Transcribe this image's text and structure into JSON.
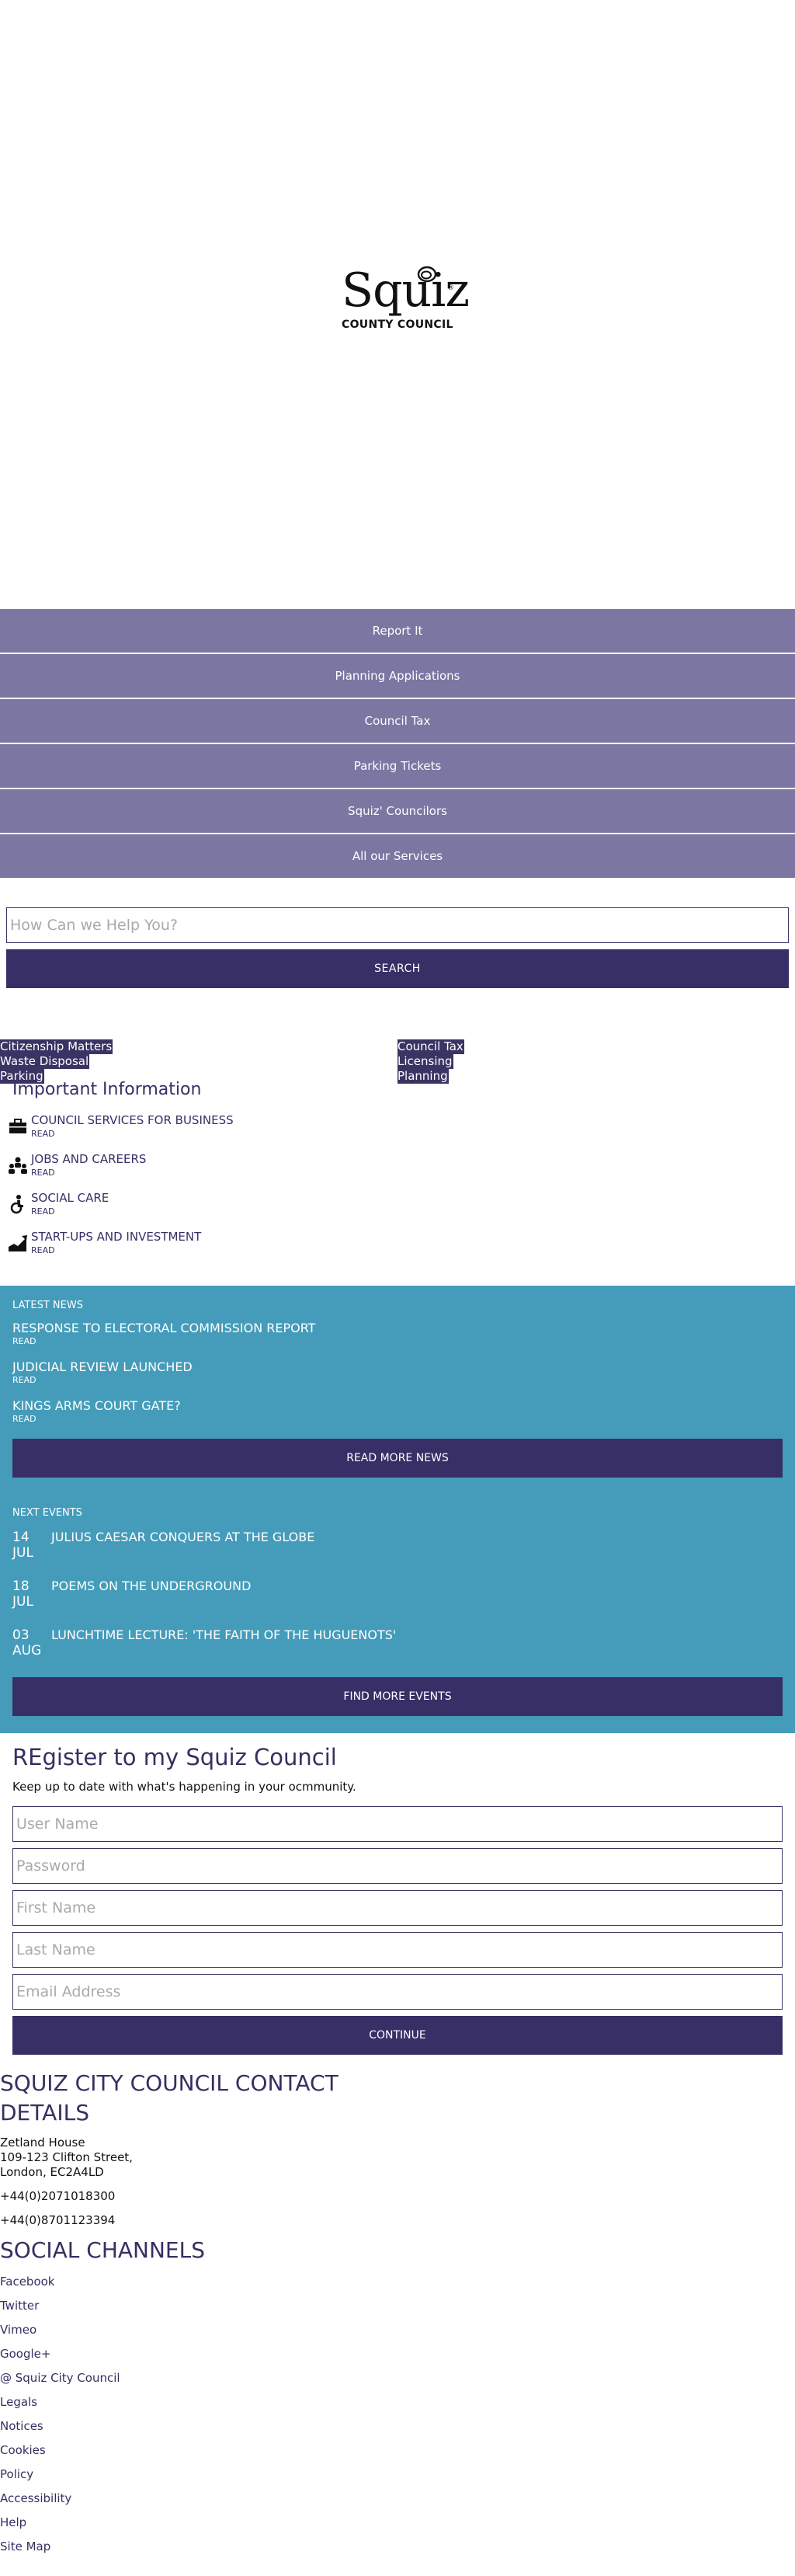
{
  "logo": {
    "word": "Squiz",
    "subtitle": "COUNTY COUNCIL",
    "reg": "®"
  },
  "quick_links": [
    "Report It",
    "Planning Applications",
    "Council Tax",
    "Parking Tickets",
    "Squiz' Councilors",
    "All our Services"
  ],
  "search": {
    "placeholder": "How Can we Help You?",
    "button": "SEARCH"
  },
  "topics": {
    "left": [
      "Citizenship Matters",
      "Waste Disposal",
      "Parking"
    ],
    "right": [
      "Council Tax",
      "Licensing",
      "Planning"
    ]
  },
  "important": {
    "title": "Important Information",
    "items": [
      {
        "title": "COUNCIL SERVICES FOR BUSINESS",
        "read": "READ",
        "icon": "briefcase-icon"
      },
      {
        "title": "JOBS AND CAREERS",
        "read": "READ",
        "icon": "people-icon"
      },
      {
        "title": "SOCIAL CARE",
        "read": "READ",
        "icon": "care-icon"
      },
      {
        "title": "START-UPS AND INVESTMENT",
        "read": "READ",
        "icon": "chart-icon"
      }
    ]
  },
  "news": {
    "label": "LATEST NEWS",
    "items": [
      {
        "title": "RESPONSE TO ELECTORAL COMMISSION REPORT",
        "read": "READ"
      },
      {
        "title": "JUDICIAL REVIEW LAUNCHED",
        "read": "READ"
      },
      {
        "title": "KINGS ARMS COURT GATE?",
        "read": "READ"
      }
    ],
    "button": "READ MORE NEWS"
  },
  "events": {
    "label": "NEXT EVENTS",
    "items": [
      {
        "day": "14",
        "month": "JUL",
        "title": "JULIUS CAESAR CONQUERS AT THE GLOBE"
      },
      {
        "day": "18",
        "month": "JUL",
        "title": "POEMS ON THE UNDERGROUND"
      },
      {
        "day": "03",
        "month": "AUG",
        "title": "LUNCHTIME LECTURE: 'THE FAITH OF THE HUGUENOTS'"
      }
    ],
    "button": "FIND MORE EVENTS"
  },
  "register": {
    "title": "REgister to my Squiz Council",
    "intro": "Keep up to date with what's happening in your ocmmunity.",
    "fields": [
      "User Name",
      "Password",
      "First Name",
      "Last Name",
      "Email Address"
    ],
    "button": "CONTINUE"
  },
  "contact": {
    "title": "SQUIZ CITY COUNCIL CONTACT DETAILS",
    "address": [
      "Zetland House",
      "109-123 Clifton Street,",
      "London, EC2A4LD"
    ],
    "phone1": "+44(0)2071018300",
    "phone2": "+44(0)8701123394"
  },
  "social": {
    "title": "SOCIAL CHANNELS",
    "links": [
      "Facebook",
      "Twitter",
      "Vimeo",
      "Google+",
      "@ Squiz City Council",
      "Legals",
      "Notices",
      "Cookies",
      "Policy",
      "Accessibility",
      "Help",
      "Site Map"
    ]
  },
  "colors": {
    "quick_bg": "#7b76a2",
    "dark": "#372f66",
    "blue": "#449cba"
  }
}
